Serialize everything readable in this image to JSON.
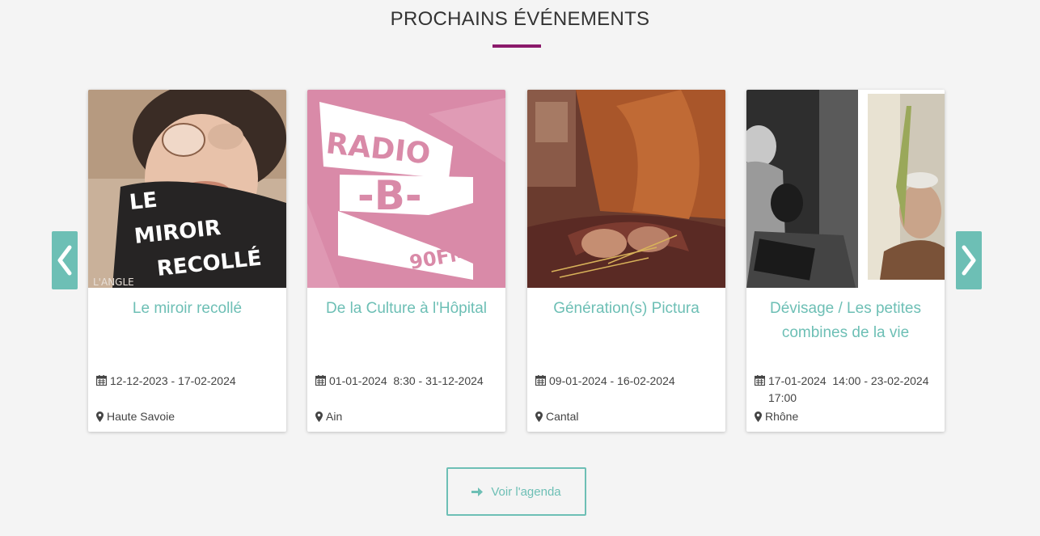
{
  "section": {
    "title": "PROCHAINS ÉVÉNEMENTS",
    "accent_color": "#8b1a6b",
    "theme_color": "#6dbfb5"
  },
  "carousel": {
    "prev_icon": "chevron-left-icon",
    "next_icon": "chevron-right-icon"
  },
  "events": [
    {
      "title": "Le miroir recollé",
      "date": "12-12-2023 - 17-02-2024",
      "place": "Haute Savoie",
      "poster_text": [
        "LE",
        "MIROIR",
        "RECOLLÉ"
      ],
      "poster_credit": "L'ANGLE"
    },
    {
      "title": "De la Culture à l'Hôpital",
      "date": "01-01-2024  8:30 - 31-12-2024",
      "place": "Ain",
      "poster_text": [
        "RADIO",
        "-B-",
        "90FM"
      ]
    },
    {
      "title": "Génération(s) Pictura",
      "date": "09-01-2024 - 16-02-2024",
      "place": "Cantal"
    },
    {
      "title": "Dévisage / Les petites combines de la vie",
      "date": "17-01-2024  14:00 - 23-02-2024  17:00",
      "place": "Rhône"
    }
  ],
  "footer": {
    "agenda_label": "Voir l'agenda",
    "agenda_icon": "arrow-right-icon"
  },
  "icons": {
    "date": "calendar-icon",
    "place": "map-marker-icon"
  }
}
